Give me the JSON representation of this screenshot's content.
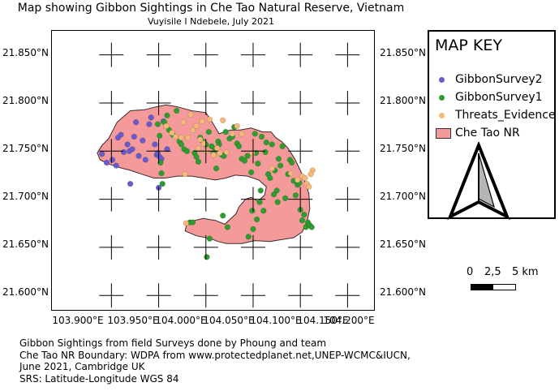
{
  "title": "Map showing Gibbon Sightings in Che Tao Natural Reserve, Vietnam",
  "subtitle": "Vuyisile I Ndebele, July 2021",
  "grid": {
    "lat_labels": [
      "21.850°N",
      "21.800°N",
      "21.750°N",
      "21.700°N",
      "21.650°N",
      "21.600°N"
    ],
    "lon_labels": [
      "103.900°E",
      "103.950°E",
      "104.000°E",
      "104.050°E",
      "104.100°E",
      "104.150°E",
      "104.200°E"
    ]
  },
  "legend": {
    "title": "MAP KEY",
    "items": [
      {
        "label": "GibbonSurvey2",
        "color": "#6a5acd"
      },
      {
        "label": "GibbonSurvey1",
        "color": "#2e9c2e"
      },
      {
        "label": "Threats_Evidence",
        "color": "#f4b97a"
      },
      {
        "label": "Che Tao NR",
        "color": "#f59a9a"
      }
    ]
  },
  "scale": {
    "labels": [
      "0",
      "2,5",
      "5 km"
    ]
  },
  "footer": {
    "line1": "Gibbon Sightings from field Surveys done by Phoung and team",
    "line2": "Che Tao NR Boundary: WDPA from www.protectedplanet.net,UNEP-WCMC&IUCN,",
    "line3": "June 2021, Cambridge UK",
    "line4": "SRS: Latitude-Longitude WGS 84"
  },
  "colors": {
    "reserve_fill": "#f59a9a",
    "reserve_stroke": "#3a2a2a",
    "survey2": "#6a5acd",
    "survey1": "#2e9c2e",
    "threats": "#f4b97a"
  },
  "chart_data": {
    "type": "scatter",
    "x_units": "longitude (°E)",
    "y_units": "latitude (°N)",
    "xlim": [
      103.887,
      104.228
    ],
    "ylim": [
      21.585,
      21.875
    ],
    "reserve_boundary": [
      [
        103.947,
        21.763
      ],
      [
        103.956,
        21.78
      ],
      [
        103.97,
        21.792
      ],
      [
        103.985,
        21.793
      ],
      [
        103.997,
        21.796
      ],
      [
        104.008,
        21.798
      ],
      [
        104.02,
        21.796
      ],
      [
        104.035,
        21.792
      ],
      [
        104.05,
        21.79
      ],
      [
        104.058,
        21.778
      ],
      [
        104.064,
        21.768
      ],
      [
        104.076,
        21.772
      ],
      [
        104.086,
        21.772
      ],
      [
        104.098,
        21.774
      ],
      [
        104.11,
        21.77
      ],
      [
        104.119,
        21.77
      ],
      [
        104.124,
        21.764
      ],
      [
        104.13,
        21.76
      ],
      [
        104.137,
        21.753
      ],
      [
        104.144,
        21.742
      ],
      [
        104.15,
        21.73
      ],
      [
        104.155,
        21.718
      ],
      [
        104.159,
        21.706
      ],
      [
        104.16,
        21.69
      ],
      [
        104.157,
        21.676
      ],
      [
        104.152,
        21.666
      ],
      [
        104.143,
        21.66
      ],
      [
        104.13,
        21.658
      ],
      [
        104.118,
        21.656
      ],
      [
        104.102,
        21.657
      ],
      [
        104.088,
        21.654
      ],
      [
        104.072,
        21.654
      ],
      [
        104.063,
        21.656
      ],
      [
        104.055,
        21.659
      ],
      [
        104.04,
        21.662
      ],
      [
        104.028,
        21.667
      ],
      [
        104.03,
        21.676
      ],
      [
        104.047,
        21.68
      ],
      [
        104.06,
        21.678
      ],
      [
        104.07,
        21.674
      ],
      [
        104.082,
        21.685
      ],
      [
        104.085,
        21.692
      ],
      [
        104.092,
        21.7
      ],
      [
        104.098,
        21.702
      ],
      [
        104.105,
        21.698
      ],
      [
        104.112,
        21.704
      ],
      [
        104.114,
        21.713
      ],
      [
        104.106,
        21.72
      ],
      [
        104.094,
        21.724
      ],
      [
        104.081,
        21.725
      ],
      [
        104.071,
        21.722
      ],
      [
        104.06,
        21.72
      ],
      [
        104.048,
        21.722
      ],
      [
        104.035,
        21.724
      ],
      [
        104.02,
        21.724
      ],
      [
        104.007,
        21.722
      ],
      [
        103.995,
        21.722
      ],
      [
        103.982,
        21.726
      ],
      [
        103.97,
        21.73
      ],
      [
        103.958,
        21.733
      ],
      [
        103.946,
        21.737
      ],
      [
        103.938,
        21.741
      ],
      [
        103.935,
        21.748
      ],
      [
        103.94,
        21.756
      ]
    ],
    "series": [
      {
        "name": "GibbonSurvey2",
        "points": [
          [
            103.94,
            21.747
          ],
          [
            103.945,
            21.738
          ],
          [
            103.951,
            21.741
          ],
          [
            103.955,
            21.735
          ],
          [
            103.957,
            21.764
          ],
          [
            103.96,
            21.767
          ],
          [
            103.963,
            21.749
          ],
          [
            103.967,
            21.757
          ],
          [
            103.969,
            21.75
          ],
          [
            103.97,
            21.716
          ],
          [
            103.972,
            21.752
          ],
          [
            103.974,
            21.765
          ],
          [
            103.976,
            21.78
          ],
          [
            103.979,
            21.745
          ],
          [
            103.983,
            21.761
          ],
          [
            103.986,
            21.741
          ],
          [
            103.99,
            21.778
          ],
          [
            103.992,
            21.785
          ],
          [
            103.996,
            21.757
          ],
          [
            103.998,
            21.746
          ],
          [
            103.999,
            21.748
          ],
          [
            104.0,
            21.712
          ],
          [
            104.001,
            21.744
          ],
          [
            104.003,
            21.742
          ],
          [
            104.005,
            21.781
          ],
          [
            104.009,
            21.752
          ]
        ]
      },
      {
        "name": "GibbonSurvey1",
        "points": [
          [
            103.999,
            21.778
          ],
          [
            104.001,
            21.766
          ],
          [
            104.002,
            21.738
          ],
          [
            104.003,
            21.727
          ],
          [
            104.004,
            21.716
          ],
          [
            104.006,
            21.78
          ],
          [
            104.009,
            21.787
          ],
          [
            104.011,
            21.772
          ],
          [
            104.015,
            21.767
          ],
          [
            104.019,
            21.792
          ],
          [
            104.022,
            21.76
          ],
          [
            104.024,
            21.757
          ],
          [
            104.027,
            21.752
          ],
          [
            104.03,
            21.75
          ],
          [
            104.033,
            21.676
          ],
          [
            104.036,
            21.676
          ],
          [
            104.038,
            21.748
          ],
          [
            104.04,
            21.744
          ],
          [
            104.042,
            21.739
          ],
          [
            104.044,
            21.764
          ],
          [
            104.047,
            21.76
          ],
          [
            104.05,
            21.757
          ],
          [
            104.051,
            21.64
          ],
          [
            104.053,
            21.77
          ],
          [
            104.054,
            21.659
          ],
          [
            104.056,
            21.755
          ],
          [
            104.058,
            21.748
          ],
          [
            104.06,
            21.752
          ],
          [
            104.061,
            21.732
          ],
          [
            104.063,
            21.76
          ],
          [
            104.064,
            21.757
          ],
          [
            104.067,
            21.746
          ],
          [
            104.068,
            21.683
          ],
          [
            104.069,
            21.745
          ],
          [
            104.071,
            21.77
          ],
          [
            104.073,
            21.671
          ],
          [
            104.075,
            21.763
          ],
          [
            104.078,
            21.765
          ],
          [
            104.08,
            21.775
          ],
          [
            104.083,
            21.758
          ],
          [
            104.085,
            21.755
          ],
          [
            104.088,
            21.742
          ],
          [
            104.091,
            21.74
          ],
          [
            104.094,
            21.745
          ],
          [
            104.095,
            21.661
          ],
          [
            104.098,
            21.728
          ],
          [
            104.099,
            21.688
          ],
          [
            104.1,
            21.669
          ],
          [
            104.102,
            21.768
          ],
          [
            104.103,
            21.748
          ],
          [
            104.104,
            21.679
          ],
          [
            104.105,
            21.737
          ],
          [
            104.107,
            21.697
          ],
          [
            104.108,
            21.709
          ],
          [
            104.109,
            21.765
          ],
          [
            104.111,
            21.688
          ],
          [
            104.113,
            21.749
          ],
          [
            104.114,
            21.759
          ],
          [
            104.116,
            21.726
          ],
          [
            104.118,
            21.722
          ],
          [
            104.12,
            21.757
          ],
          [
            104.122,
            21.705
          ],
          [
            104.123,
            21.73
          ],
          [
            104.125,
            21.709
          ],
          [
            104.126,
            21.697
          ],
          [
            104.127,
            21.742
          ],
          [
            104.129,
            21.735
          ],
          [
            104.131,
            21.755
          ],
          [
            104.134,
            21.701
          ],
          [
            104.137,
            21.726
          ],
          [
            104.139,
            21.741
          ],
          [
            104.141,
            21.738
          ],
          [
            104.143,
            21.719
          ],
          [
            104.145,
            21.704
          ],
          [
            104.147,
            21.715
          ],
          [
            104.149,
            21.717
          ],
          [
            104.15,
            21.689
          ],
          [
            104.152,
            21.678
          ],
          [
            104.154,
            21.684
          ],
          [
            104.156,
            21.671
          ],
          [
            104.158,
            21.676
          ],
          [
            104.16,
            21.673
          ],
          [
            104.162,
            21.671
          ]
        ]
      },
      {
        "name": "Threats_Evidence",
        "points": [
          [
            104.008,
            21.776
          ],
          [
            104.014,
            21.769
          ],
          [
            104.018,
            21.765
          ],
          [
            104.024,
            21.764
          ],
          [
            104.026,
            21.78
          ],
          [
            104.028,
            21.726
          ],
          [
            104.029,
            21.675
          ],
          [
            104.031,
            21.764
          ],
          [
            104.034,
            21.788
          ],
          [
            104.036,
            21.772
          ],
          [
            104.04,
            21.776
          ],
          [
            104.042,
            21.753
          ],
          [
            104.044,
            21.762
          ],
          [
            104.046,
            21.781
          ],
          [
            104.048,
            21.758
          ],
          [
            104.05,
            21.75
          ],
          [
            104.054,
            21.783
          ],
          [
            104.058,
            21.746
          ],
          [
            104.062,
            21.753
          ],
          [
            104.065,
            21.748
          ],
          [
            104.068,
            21.782
          ],
          [
            104.072,
            21.749
          ],
          [
            104.078,
            21.768
          ],
          [
            104.083,
            21.776
          ],
          [
            104.088,
            21.768
          ],
          [
            104.099,
            21.748
          ],
          [
            104.12,
            21.732
          ],
          [
            104.14,
            21.727
          ],
          [
            104.147,
            21.72
          ],
          [
            104.152,
            21.724
          ],
          [
            104.155,
            21.722
          ],
          [
            104.157,
            21.716
          ],
          [
            104.159,
            21.713
          ],
          [
            104.163,
            21.73
          ],
          [
            104.161,
            21.726
          ]
        ]
      }
    ]
  }
}
